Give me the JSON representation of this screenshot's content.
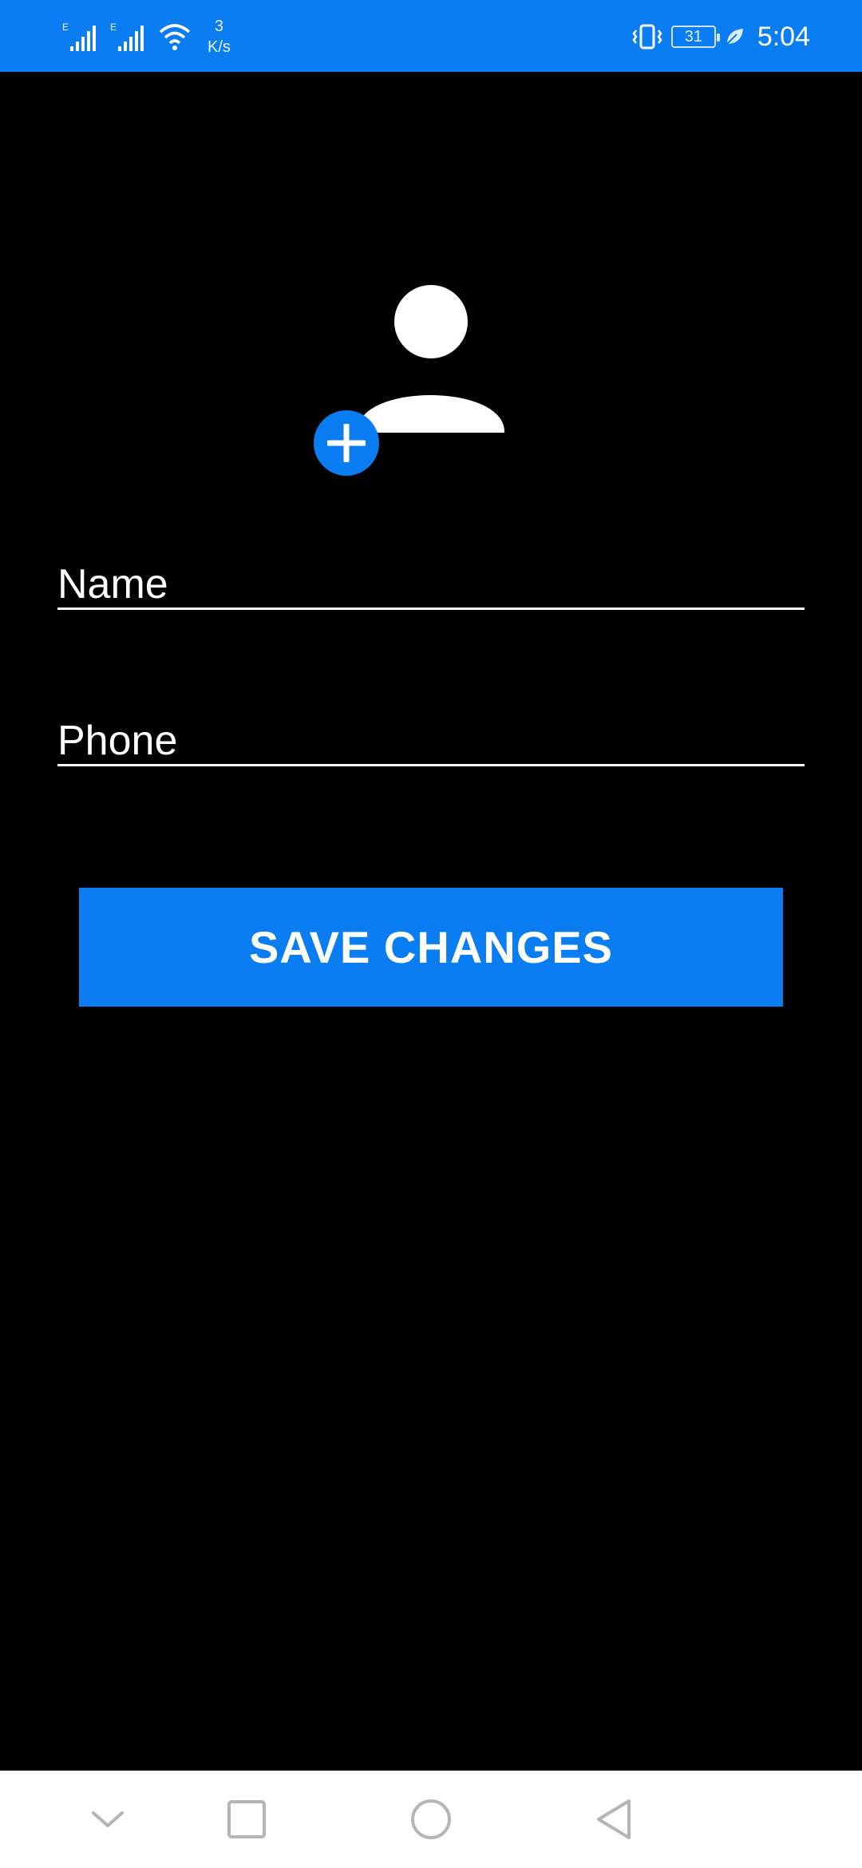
{
  "status_bar": {
    "net_speed_value": "3",
    "net_speed_unit": "K/s",
    "battery_level": "31",
    "time": "5:04",
    "signal_label_1": "E",
    "signal_label_2": "E"
  },
  "profile": {
    "avatar_icon": "person-icon",
    "add_photo_icon": "plus-icon"
  },
  "form": {
    "name_placeholder": "Name",
    "name_value": "",
    "phone_placeholder": "Phone",
    "phone_value": ""
  },
  "actions": {
    "save_label": "SAVE CHANGES"
  },
  "nav_bar": {
    "icons": [
      "chevron-down-icon",
      "square-icon",
      "circle-icon",
      "triangle-back-icon"
    ]
  },
  "colors": {
    "accent": "#0A7DF2",
    "background": "#000000",
    "text": "#FFFFFF",
    "nav_background": "#FFFFFF"
  }
}
